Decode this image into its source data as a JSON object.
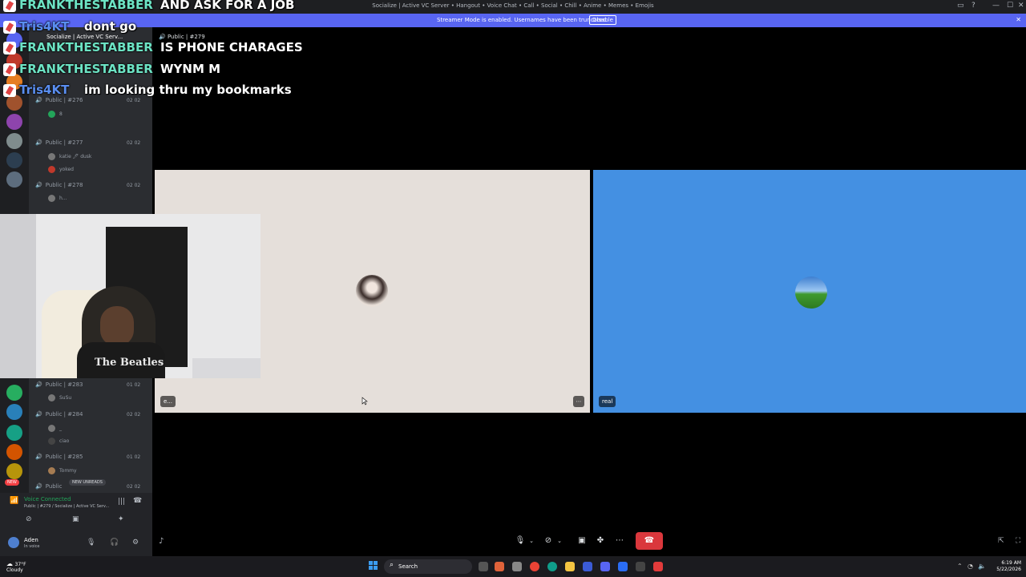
{
  "window": {
    "title": "Socialize | Active VC Server • Hangout • Voice Chat • Call • Social • Chill • Anime • Memes • Emojis",
    "controls": [
      "—",
      "☐",
      "✕"
    ]
  },
  "streamer_bar": {
    "message": "Streamer Mode is enabled. Usernames have been truncated.",
    "button": "Disable",
    "color": "#5865f2"
  },
  "sidebar": {
    "server_name": "Socialize | Active VC Serv...",
    "channels": [
      {
        "name": "Public | #276",
        "count": "02",
        "limit": "02",
        "users": [
          "8",
          ""
        ]
      },
      {
        "name": "Public | #277",
        "count": "02",
        "limit": "02",
        "users": [
          "katie 🖊 dusk",
          "yoked"
        ]
      },
      {
        "name": "Public | #278",
        "count": "02",
        "limit": "02",
        "users": [
          "h...",
          ""
        ]
      },
      {
        "name": "Public | #283",
        "count": "01",
        "limit": "02",
        "users": [
          "SuSu"
        ]
      },
      {
        "name": "Public | #284",
        "count": "02",
        "limit": "02",
        "users": [
          "_",
          "ciao"
        ]
      },
      {
        "name": "Public | #285",
        "count": "01",
        "limit": "02",
        "users": [
          "Tommy"
        ]
      },
      {
        "name": "Public",
        "count": "02",
        "limit": "02",
        "users": []
      }
    ],
    "new_badge": "NEW",
    "new_unreads": "NEW UNREADS"
  },
  "voice_panel": {
    "status": "Voice Connected",
    "channel": "Public | #279 / Socialize | Active VC Serv..."
  },
  "user": {
    "name": "Aden",
    "status": "In voice"
  },
  "channel_header": "Public | #279",
  "tiles": [
    {
      "label": "e...",
      "bg": "#e5dfda"
    },
    {
      "label": "real",
      "bg": "#4490e2"
    }
  ],
  "webcam": {
    "shirt_text": "The Beatles"
  },
  "chat": [
    {
      "user": "FRANKTHESTABBER",
      "message": "AND ASK FOR A JOB",
      "color": "#6ce3c4"
    },
    {
      "user": "Tris4KT",
      "message": "dont go",
      "color": "#5a8ef0"
    },
    {
      "user": "FRANKTHESTABBER",
      "message": "IS PHONE CHARAGES",
      "color": "#6ce3c4"
    },
    {
      "user": "FRANKTHESTABBER",
      "message": "WYNM M",
      "color": "#6ce3c4"
    },
    {
      "user": "Tris4KT",
      "message": "im looking thru my bookmarks",
      "color": "#5a8ef0"
    }
  ],
  "call_controls": {
    "icons": [
      "microphone-icon",
      "camera-off-icon",
      "screen-share-icon",
      "activities-icon",
      "more-icon",
      "hang-up-icon"
    ],
    "hangup_color": "#da373c"
  },
  "taskbar": {
    "weather_temp": "37°F",
    "weather_desc": "Cloudy",
    "search": "Search",
    "time": "6:19 AM",
    "date": "5/22/2026"
  }
}
